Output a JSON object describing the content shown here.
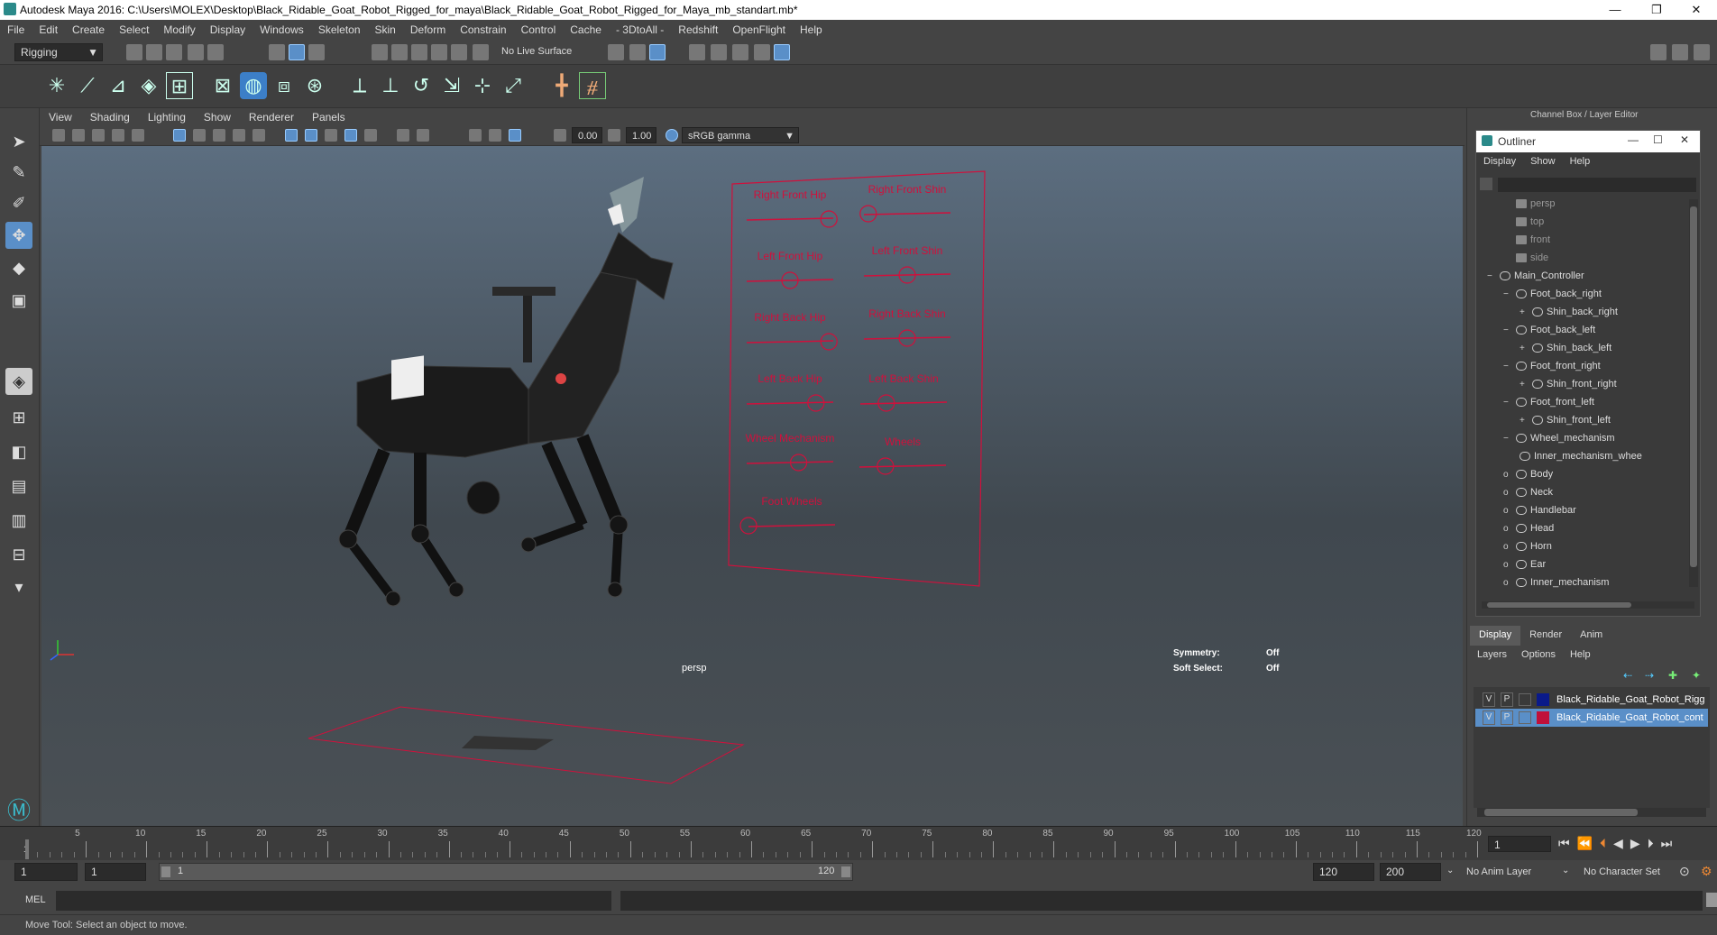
{
  "window": {
    "title": "Autodesk Maya 2016: C:\\Users\\MOLEX\\Desktop\\Black_Ridable_Goat_Robot_Rigged_for_maya\\Black_Ridable_Goat_Robot_Rigged_for_Maya_mb_standart.mb*",
    "minimize": "—",
    "maximize": "❐",
    "close": "✕"
  },
  "menubar": [
    "File",
    "Edit",
    "Create",
    "Select",
    "Modify",
    "Display",
    "Windows",
    "Skeleton",
    "Skin",
    "Deform",
    "Constrain",
    "Control",
    "Cache",
    "- 3DtoAll -",
    "Redshift",
    "OpenFlight",
    "Help"
  ],
  "status": {
    "mode": "Rigging",
    "live_surface": "No Live Surface"
  },
  "viewport_menu": [
    "View",
    "Shading",
    "Lighting",
    "Show",
    "Renderer",
    "Panels"
  ],
  "viewport_toolbar": {
    "exposure": "0.00",
    "gamma": "1.00",
    "color_space": "sRGB gamma"
  },
  "viewport": {
    "camera_label": "persp",
    "symmetry_label": "Symmetry:",
    "symmetry_value": "Off",
    "soft_select_label": "Soft Select:",
    "soft_select_value": "Off",
    "controls": [
      {
        "label": "Right Front Hip",
        "knob": 0.95
      },
      {
        "label": "Right Front Shin",
        "knob": 0.05
      },
      {
        "label": "Left Front Hip",
        "knob": 0.5
      },
      {
        "label": "Left Front Shin",
        "knob": 0.5
      },
      {
        "label": "Right Back Hip",
        "knob": 0.95
      },
      {
        "label": "Right Back Shin",
        "knob": 0.5
      },
      {
        "label": "Left Back Hip",
        "knob": 0.8
      },
      {
        "label": "Left Back Shin",
        "knob": 0.3
      },
      {
        "label": "Wheel Mechanism",
        "knob": 0.6
      },
      {
        "label": "Wheels",
        "knob": 0.3
      },
      {
        "label": "Foot Wheels",
        "knob": 0.0
      }
    ]
  },
  "right_panel": {
    "header": "Channel Box / Layer Editor",
    "outliner_title": "Outliner",
    "outliner_menu": [
      "Display",
      "Show",
      "Help"
    ],
    "outliner_items": [
      {
        "label": "persp",
        "depth": 1,
        "type": "camera",
        "expander": ""
      },
      {
        "label": "top",
        "depth": 1,
        "type": "camera",
        "expander": ""
      },
      {
        "label": "front",
        "depth": 1,
        "type": "camera",
        "expander": ""
      },
      {
        "label": "side",
        "depth": 1,
        "type": "camera",
        "expander": ""
      },
      {
        "label": "Main_Controller",
        "depth": 0,
        "type": "curve",
        "expander": "−"
      },
      {
        "label": "Foot_back_right",
        "depth": 1,
        "type": "curve",
        "expander": "−"
      },
      {
        "label": "Shin_back_right",
        "depth": 2,
        "type": "curve",
        "expander": "+"
      },
      {
        "label": "Foot_back_left",
        "depth": 1,
        "type": "curve",
        "expander": "−"
      },
      {
        "label": "Shin_back_left",
        "depth": 2,
        "type": "curve",
        "expander": "+"
      },
      {
        "label": "Foot_front_right",
        "depth": 1,
        "type": "curve",
        "expander": "−"
      },
      {
        "label": "Shin_front_right",
        "depth": 2,
        "type": "curve",
        "expander": "+"
      },
      {
        "label": "Foot_front_left",
        "depth": 1,
        "type": "curve",
        "expander": "−"
      },
      {
        "label": "Shin_front_left",
        "depth": 2,
        "type": "curve",
        "expander": "+"
      },
      {
        "label": "Wheel_mechanism",
        "depth": 1,
        "type": "curve",
        "expander": "−"
      },
      {
        "label": "Inner_mechanism_whee",
        "depth": 2,
        "type": "curve",
        "expander": ""
      },
      {
        "label": "Body",
        "depth": 1,
        "type": "curve",
        "expander": "o"
      },
      {
        "label": "Neck",
        "depth": 1,
        "type": "curve",
        "expander": "o"
      },
      {
        "label": "Handlebar",
        "depth": 1,
        "type": "curve",
        "expander": "o"
      },
      {
        "label": "Head",
        "depth": 1,
        "type": "curve",
        "expander": "o"
      },
      {
        "label": "Horn",
        "depth": 1,
        "type": "curve",
        "expander": "o"
      },
      {
        "label": "Ear",
        "depth": 1,
        "type": "curve",
        "expander": "o"
      },
      {
        "label": "Inner_mechanism",
        "depth": 1,
        "type": "curve",
        "expander": "o"
      }
    ],
    "tabs": [
      "Display",
      "Render",
      "Anim"
    ],
    "layer_menu": [
      "Layers",
      "Options",
      "Help"
    ],
    "layers": [
      {
        "v": "V",
        "p": "P",
        "color": "#0a1a8a",
        "name": "Black_Ridable_Goat_Robot_Rigg",
        "selected": false
      },
      {
        "v": "V",
        "p": "P",
        "color": "#c0103a",
        "name": "Black_Ridable_Goat_Robot_cont",
        "selected": true
      }
    ]
  },
  "timeline": {
    "ticks": [
      "5",
      "10",
      "15",
      "20",
      "25",
      "30",
      "35",
      "40",
      "45",
      "50",
      "55",
      "60",
      "65",
      "70",
      "75",
      "80",
      "85",
      "90",
      "95",
      "100",
      "105",
      "110",
      "115",
      "120"
    ],
    "start_marker": "1",
    "current_frame": "1",
    "range_start": "1",
    "range_inner_start": "1",
    "range_slider_start": "1",
    "range_slider_end": "120",
    "range_end": "120",
    "anim_end": "200",
    "anim_layer": "No Anim Layer",
    "character_set": "No Character Set"
  },
  "command": {
    "lang": "MEL"
  },
  "help_line": "Move Tool: Select an object to move.",
  "colors": {
    "accent": "#5a8fc8",
    "rig_red": "#d0103c",
    "outliner_bg": "#3a3a3a",
    "selection": "#5a8fc8"
  }
}
